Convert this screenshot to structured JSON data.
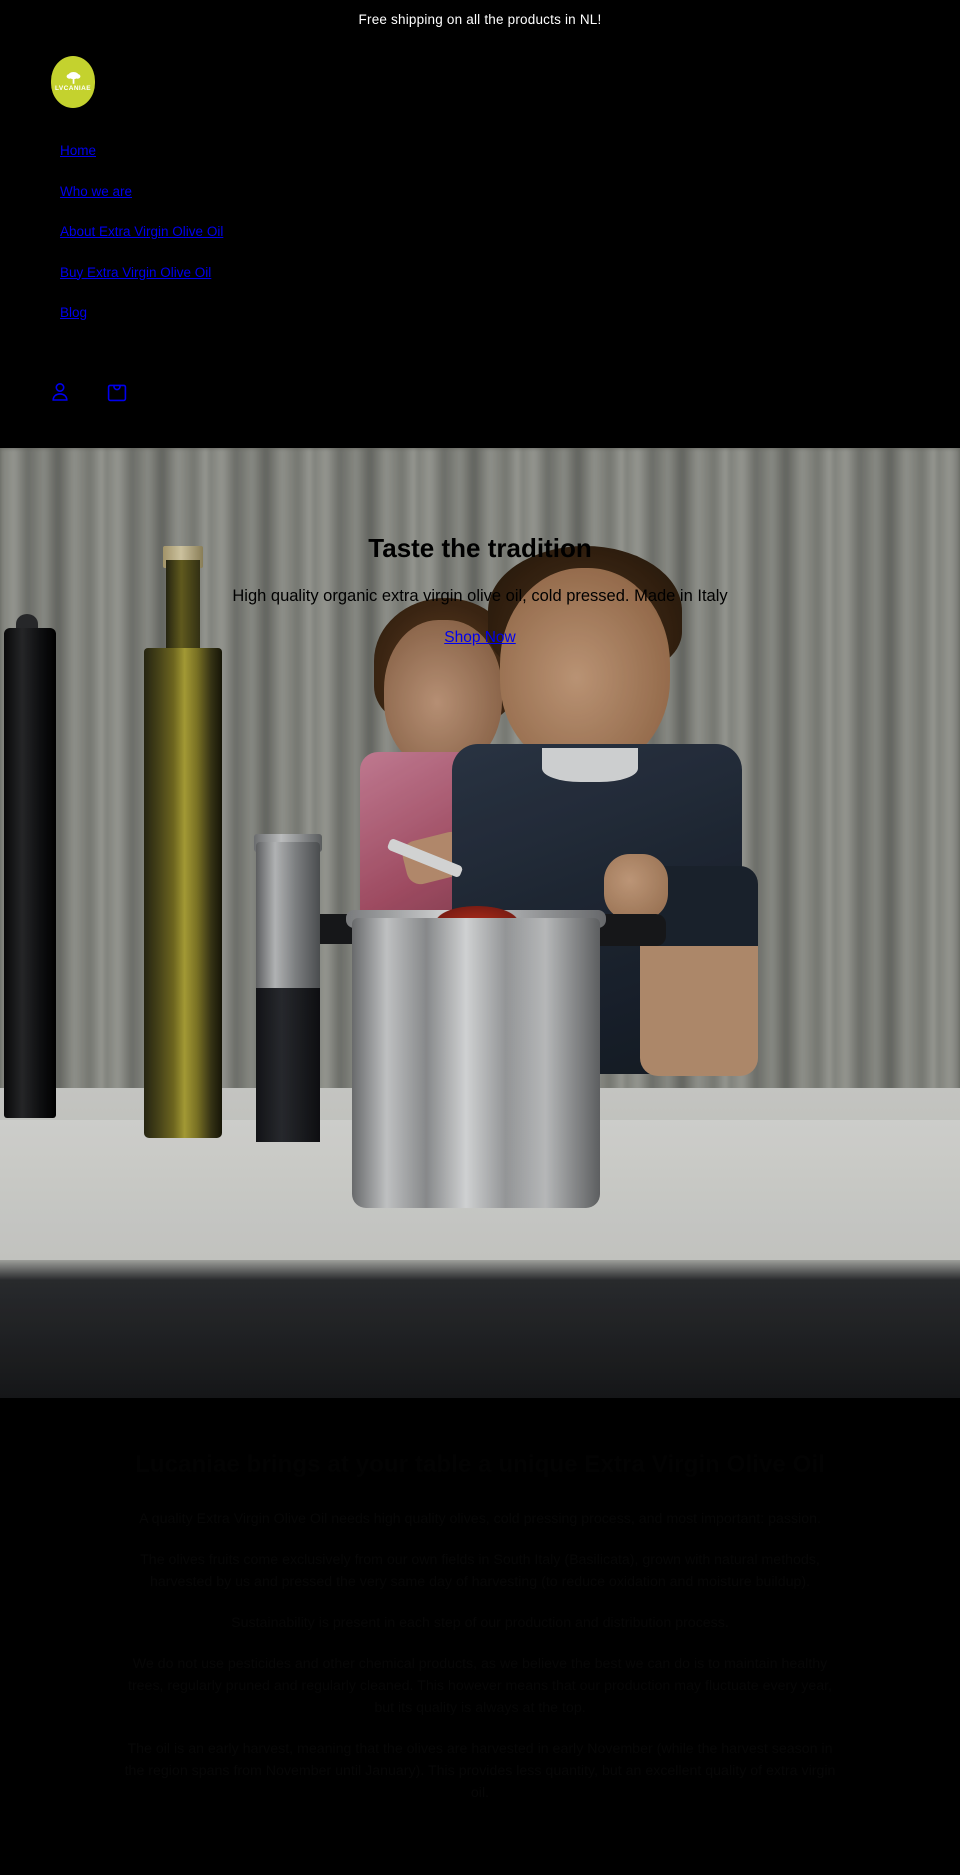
{
  "announcement": {
    "text": "Free shipping on all the products in NL!"
  },
  "header": {
    "logo": {
      "name": "lucaniae-logo",
      "wordmark": "LVCANIAE",
      "icon": "olive-tree-icon",
      "background_color": "#c4d22e"
    },
    "nav": [
      {
        "label": "Home",
        "name": "nav-home"
      },
      {
        "label": "Who we are",
        "name": "nav-who-we-are"
      },
      {
        "label": "About Extra Virgin Olive Oil",
        "name": "nav-about-extra-virgin-olive-oil"
      },
      {
        "label": "Buy Extra Virgin Olive Oil",
        "name": "nav-buy-extra-virgin-olive-oil"
      },
      {
        "label": "Blog",
        "name": "nav-blog"
      }
    ],
    "icons": [
      {
        "name": "account-icon",
        "label": "Account"
      },
      {
        "name": "shopping-bag-icon",
        "label": "Cart"
      }
    ],
    "link_color": "#0000ee"
  },
  "hero": {
    "title": "Taste the tradition",
    "subtitle": "High quality organic extra virgin olive oil, cold pressed. Made in Italy",
    "cta_label": "Shop Now",
    "image_alt": "Two children cooking at a kitchen counter with a bottle of olive oil and a steel pot"
  },
  "about": {
    "title": "Lucaniae brings at your table a unique Extra Virgin Olive Oil",
    "paragraphs": [
      "A quality Extra Virgin Olive Oil needs high quality olives, cold pressing process, and most important: passion.",
      "The olives fruits come exclusively from our own fields in South Italy (Basilicata), grown with natural methods, harvested by us and pressed the very same day of harvesting (to reduce oxidation and moisture buildup).",
      "Sustainability is present in each step of our production and distribution process.",
      "We do not use pesticides and other chemical products, as we believe the best we can do is to maintain healthy trees, regularly pruned and regularly cleaned. This however means that our production may fluctuate every year, but its quality is always at the top.",
      "The oil is an early harvest, meaning that the olives are harvested in early November (while the harvest season in the region spans from November until January). This provides less quantity, but an excellent quality of extra virgin oil."
    ]
  }
}
